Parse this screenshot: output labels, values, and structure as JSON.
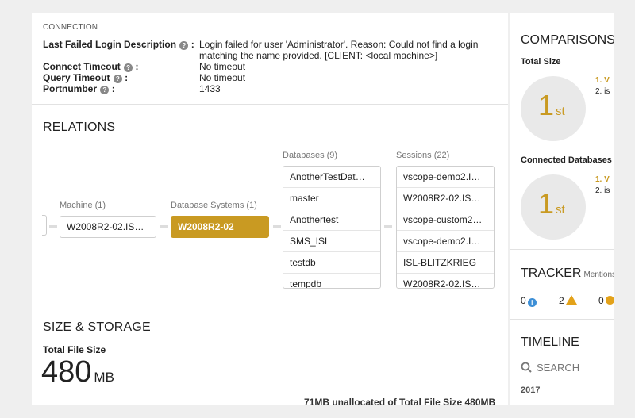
{
  "connection": {
    "heading": "CONNECTION",
    "rows": [
      {
        "label": "Last Failed Login Description",
        "value": "Login failed for user 'Administrator'. Reason: Could not find a login matching the name provided. [CLIENT: <local machine>]"
      },
      {
        "label": "Connect Timeout",
        "value": "No timeout"
      },
      {
        "label": "Query Timeout",
        "value": "No timeout"
      },
      {
        "label": "Portnumber",
        "value": "1433"
      }
    ],
    "help_glyph": "?"
  },
  "relations": {
    "title": "RELATIONS",
    "machine": {
      "header": "Machine (1)",
      "item": "W2008R2-02.IS…"
    },
    "db_systems": {
      "header": "Database Systems (1)",
      "item": "W2008R2-02"
    },
    "databases": {
      "header": "Databases (9)",
      "items": [
        "AnotherTestDat…",
        "master",
        "Anothertest",
        "SMS_ISL",
        "testdb",
        "tempdb"
      ]
    },
    "sessions": {
      "header": "Sessions (22)",
      "items": [
        "vscope-demo2.I…",
        "W2008R2-02.IS…",
        "vscope-custom2…",
        "vscope-demo2.I…",
        "ISL-BLITZKRIEG",
        "W2008R2-02.IS…"
      ]
    }
  },
  "size_storage": {
    "title": "SIZE & STORAGE",
    "total_label": "Total File Size",
    "total_value": "480",
    "total_unit": "MB",
    "unallocated_text": "71MB unallocated of Total File Size 480MB"
  },
  "comparisons": {
    "title": "COMPARISONS",
    "groups": [
      {
        "label": "Total Size",
        "rank": "1",
        "suffix": "st",
        "list": [
          "1. V",
          "2. is"
        ]
      },
      {
        "label": "Connected Databases",
        "rank": "1",
        "suffix": "st",
        "list": [
          "1. V",
          "2. is"
        ]
      }
    ]
  },
  "tracker": {
    "title": "TRACKER",
    "mentions_label": "Mentions",
    "info_count": "0",
    "warning_count": "2",
    "error_count": "0",
    "info_glyph": "i",
    "colors": {
      "info": "#3d8fd6",
      "warning": "#e3a21a",
      "error": "#e3a21a"
    }
  },
  "timeline": {
    "title": "TIMELINE",
    "search_label": "SEARCH",
    "year": "2017"
  },
  "theme": {
    "accent": "#c99a22"
  }
}
